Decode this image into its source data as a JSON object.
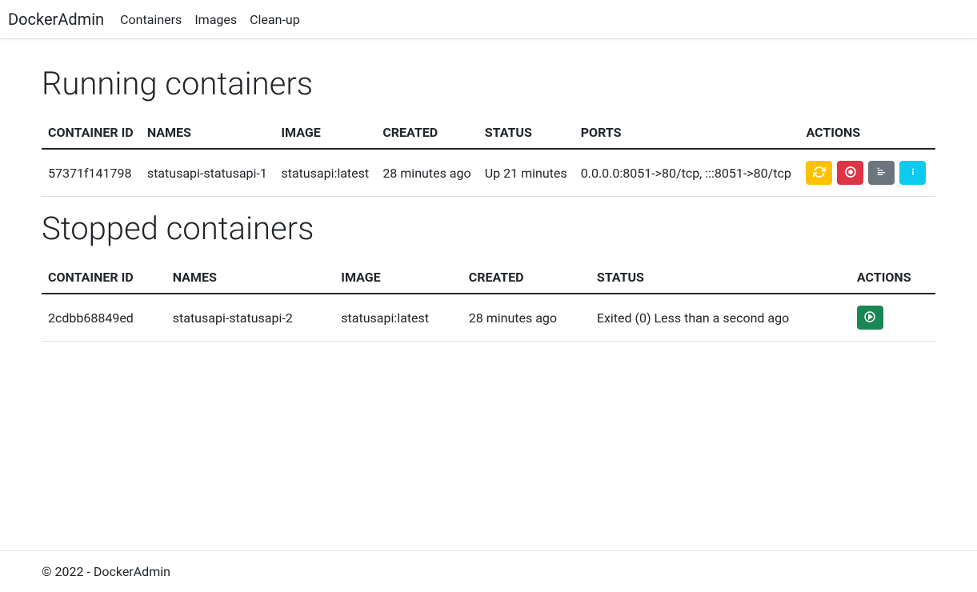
{
  "brand": "DockerAdmin",
  "nav": {
    "containers": "Containers",
    "images": "Images",
    "cleanup": "Clean-up"
  },
  "running": {
    "title": "Running containers",
    "headers": {
      "id": "CONTAINER ID",
      "names": "NAMES",
      "image": "IMAGE",
      "created": "CREATED",
      "status": "STATUS",
      "ports": "PORTS",
      "actions": "ACTIONS"
    },
    "rows": [
      {
        "id": "57371f141798",
        "names": "statusapi-statusapi-1",
        "image": "statusapi:latest",
        "created": "28 minutes ago",
        "status": "Up 21 minutes",
        "ports": "0.0.0.0:8051->80/tcp, :::8051->80/tcp"
      }
    ]
  },
  "stopped": {
    "title": "Stopped containers",
    "headers": {
      "id": "CONTAINER ID",
      "names": "NAMES",
      "image": "IMAGE",
      "created": "CREATED",
      "status": "STATUS",
      "actions": "ACTIONS"
    },
    "rows": [
      {
        "id": "2cdbb68849ed",
        "names": "statusapi-statusapi-2",
        "image": "statusapi:latest",
        "created": "28 minutes ago",
        "status": "Exited (0) Less than a second ago"
      }
    ]
  },
  "footer": "© 2022 - DockerAdmin"
}
